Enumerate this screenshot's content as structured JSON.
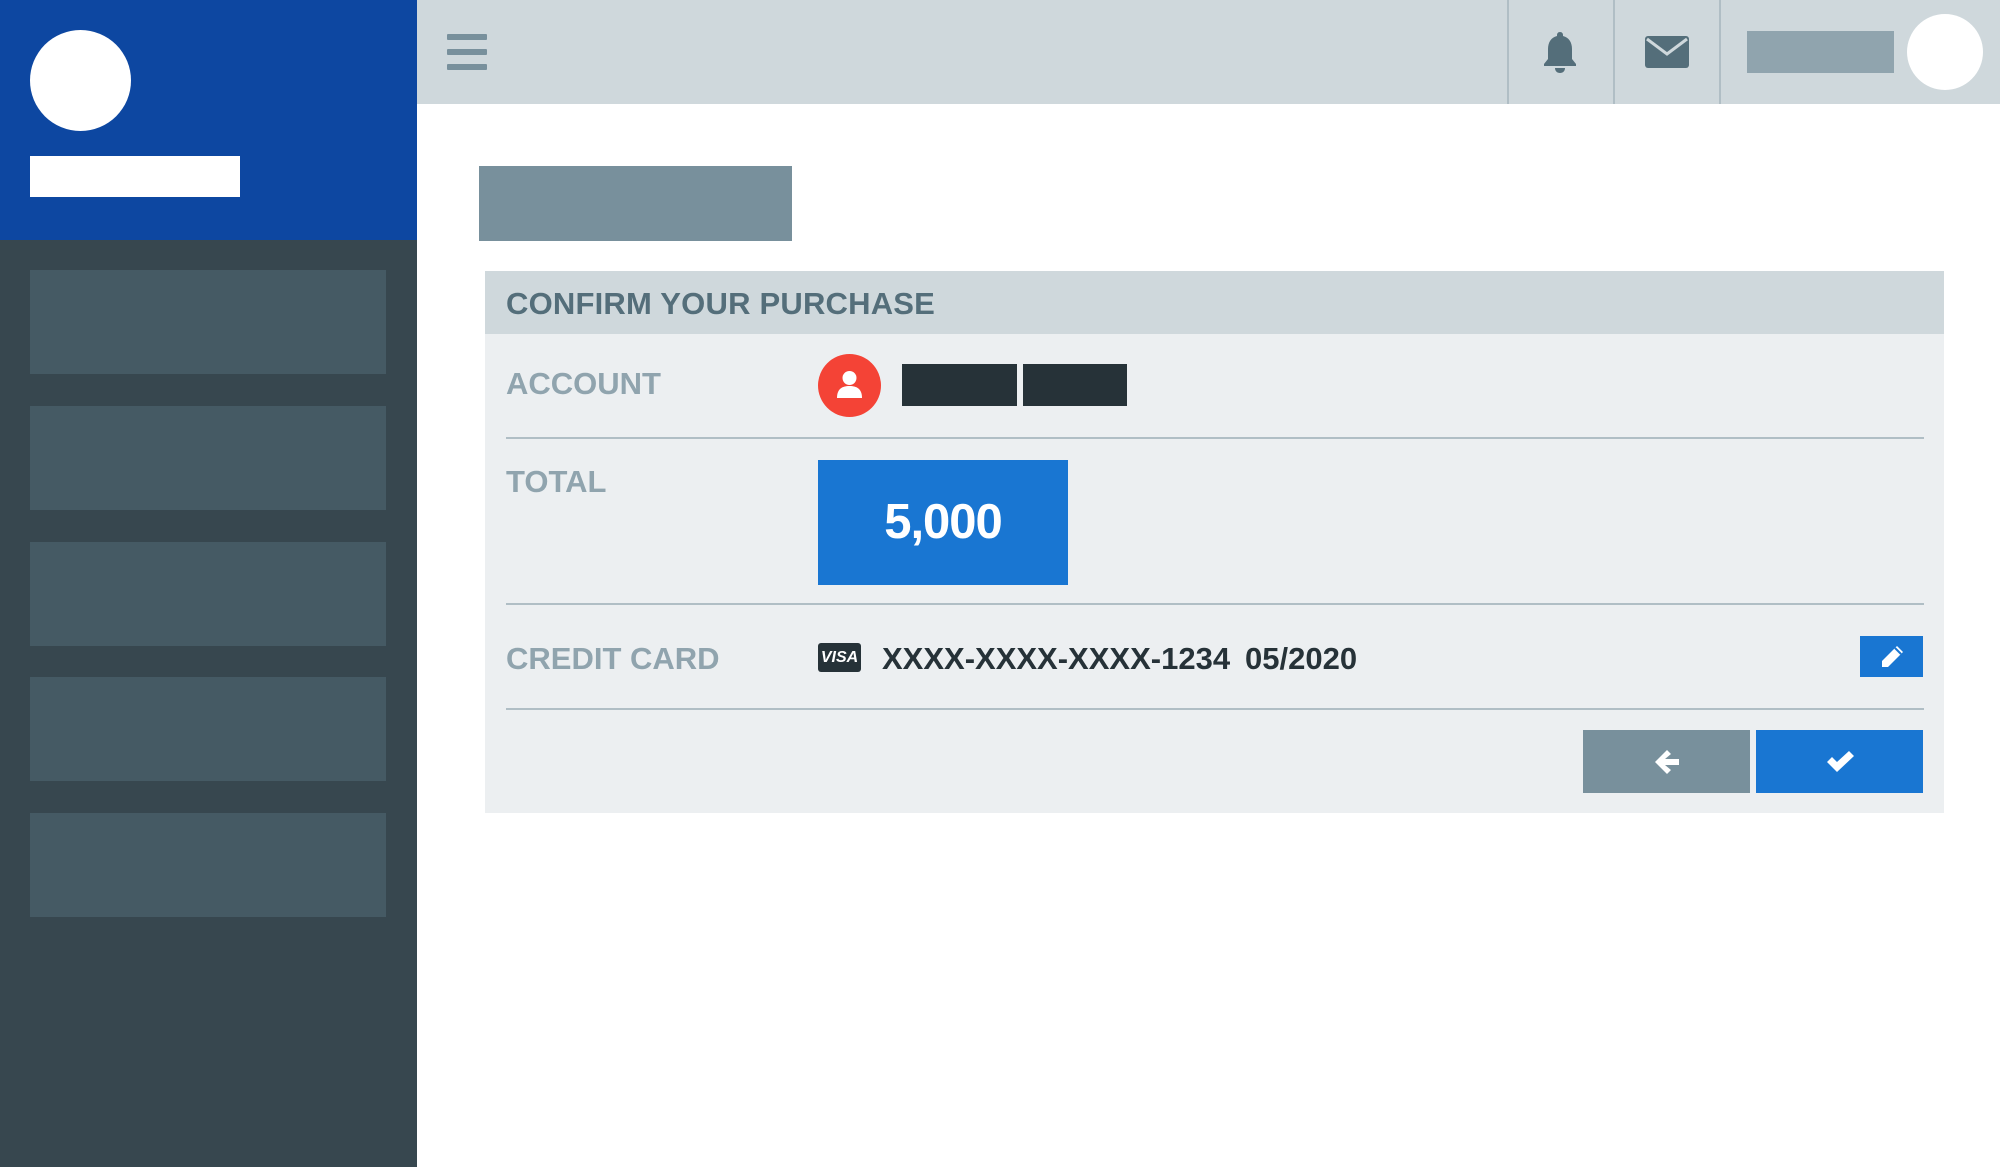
{
  "colors": {
    "brand_blue": "#0d47a1",
    "sidebar_dark": "#37474f",
    "accent_blue": "#1976d2",
    "account_red": "#f44336",
    "slate": "#78909c"
  },
  "sidebar": {
    "items": [
      {
        "label": ""
      },
      {
        "label": ""
      },
      {
        "label": ""
      },
      {
        "label": ""
      },
      {
        "label": ""
      }
    ]
  },
  "topbar": {
    "icons": [
      "menu-icon",
      "bell-icon",
      "envelope-icon"
    ]
  },
  "panel": {
    "title": "CONFIRM YOUR PURCHASE",
    "account": {
      "label": "ACCOUNT",
      "icon": "user-icon"
    },
    "total": {
      "label": "TOTAL",
      "value": "5,000"
    },
    "credit_card": {
      "label": "CREDIT CARD",
      "brand": "VISA",
      "number": "XXXX-XXXX-XXXX-1234",
      "expiry": "05/2020",
      "edit_icon": "pencil-icon"
    },
    "actions": {
      "back_icon": "arrow-left-icon",
      "confirm_icon": "check-icon"
    }
  }
}
